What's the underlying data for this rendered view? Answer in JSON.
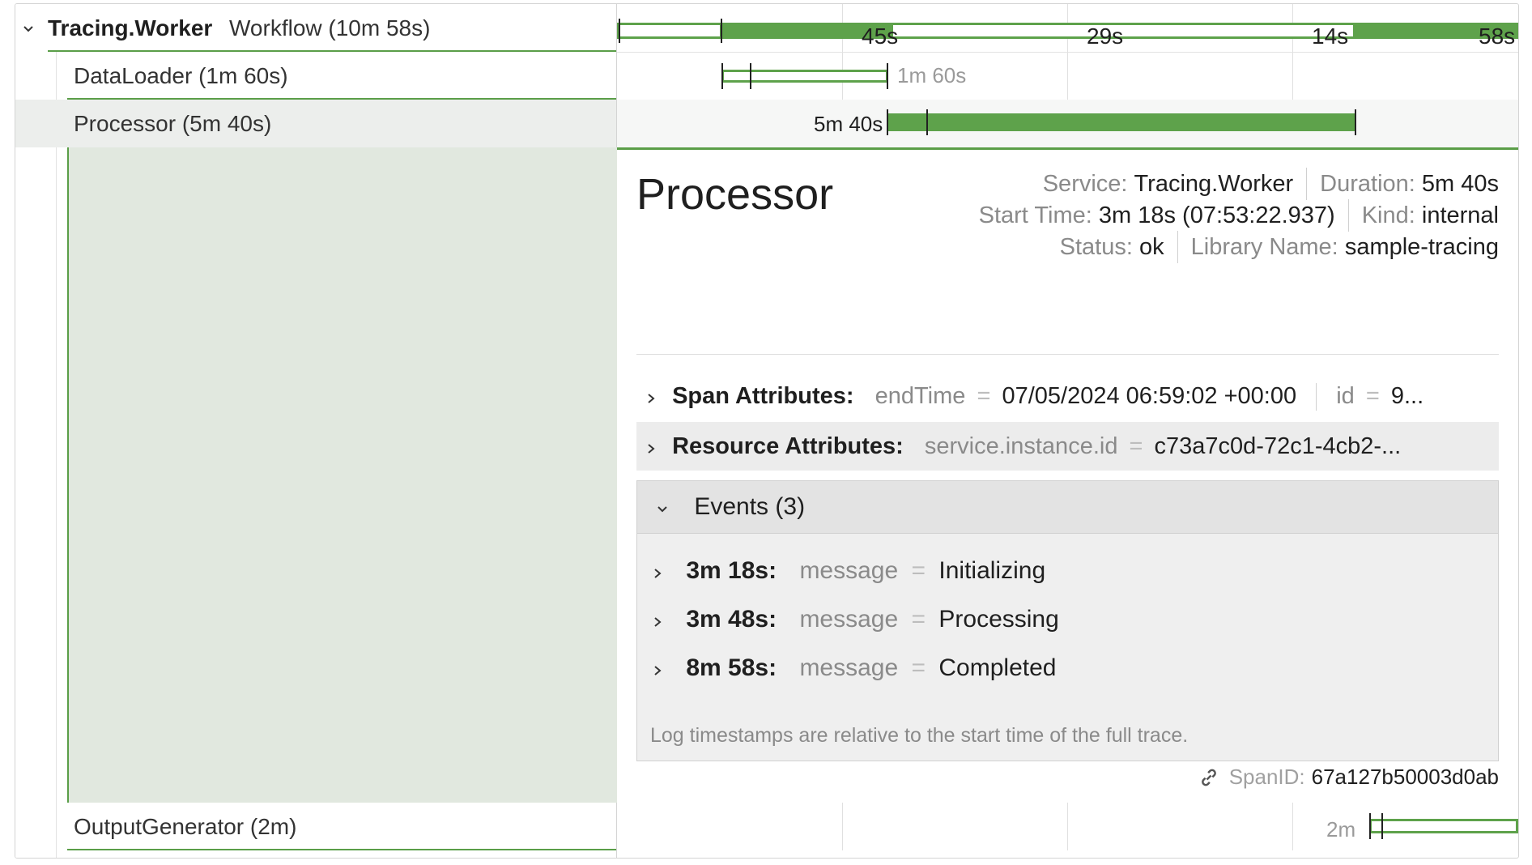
{
  "root": {
    "name": "Tracing.Worker",
    "meta": "Workflow (10m 58s)",
    "ticks": [
      "45s",
      "29s",
      "14s",
      "58s"
    ]
  },
  "spans": [
    {
      "label": "DataLoader (1m 60s)",
      "bar_label": "1m 60s"
    },
    {
      "label": "Processor (5m 40s)",
      "bar_label": "5m 40s"
    },
    {
      "label": "OutputGenerator (2m)",
      "bar_label": "2m"
    }
  ],
  "detail": {
    "title": "Processor",
    "service_key": "Service:",
    "service_val": "Tracing.Worker",
    "duration_key": "Duration:",
    "duration_val": "5m 40s",
    "start_key": "Start Time:",
    "start_val": "3m 18s (07:53:22.937)",
    "kind_key": "Kind:",
    "kind_val": "internal",
    "status_key": "Status:",
    "status_val": "ok",
    "library_key": "Library Name:",
    "library_val": "sample-tracing",
    "span_attrs": {
      "title": "Span Attributes:",
      "k1": "endTime",
      "eq": "=",
      "v1": "07/05/2024 06:59:02 +00:00",
      "k2": "id",
      "v2": "9..."
    },
    "resource_attrs": {
      "title": "Resource Attributes:",
      "k1": "service.instance.id",
      "eq": "=",
      "v1": "c73a7c0d-72c1-4cb2-..."
    },
    "events": {
      "title": "Events (3)",
      "items": [
        {
          "time": "3m 18s:",
          "key": "message",
          "eq": "=",
          "value": "Initializing"
        },
        {
          "time": "3m 48s:",
          "key": "message",
          "eq": "=",
          "value": "Processing"
        },
        {
          "time": "8m 58s:",
          "key": "message",
          "eq": "=",
          "value": "Completed"
        }
      ],
      "note": "Log timestamps are relative to the start time of the full trace."
    },
    "span_id_key": "SpanID:",
    "span_id_val": "67a127b50003d0ab"
  }
}
